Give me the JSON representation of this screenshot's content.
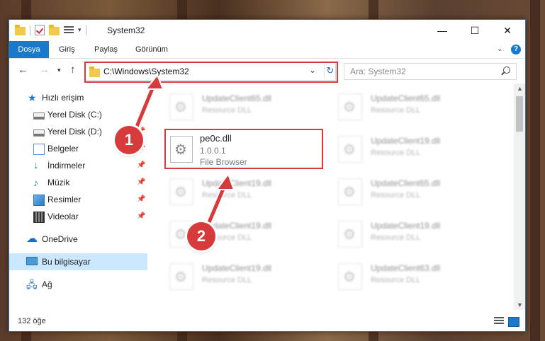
{
  "window": {
    "title": "System32",
    "minimize_icon": "minimize-icon",
    "maximize_icon": "maximize-icon",
    "close_icon": "close-icon"
  },
  "ribbon": {
    "tabs": [
      "Dosya",
      "Giriş",
      "Paylaş",
      "Görünüm"
    ]
  },
  "address": {
    "path": "C:\\Windows\\System32"
  },
  "search": {
    "placeholder": "Ara: System32"
  },
  "sidebar": {
    "items": [
      {
        "label": "Hızlı erişim",
        "icon": "star-icon"
      },
      {
        "label": "Yerel Disk (C:)",
        "icon": "drive-icon"
      },
      {
        "label": "Yerel Disk (D:)",
        "icon": "drive-icon"
      },
      {
        "label": "Belgeler",
        "icon": "documents-icon"
      },
      {
        "label": "İndirmeler",
        "icon": "download-icon"
      },
      {
        "label": "Müzik",
        "icon": "music-icon"
      },
      {
        "label": "Resimler",
        "icon": "pictures-icon"
      },
      {
        "label": "Videolar",
        "icon": "videos-icon"
      },
      {
        "label": "OneDrive",
        "icon": "cloud-icon"
      },
      {
        "label": "Bu bilgisayar",
        "icon": "computer-icon"
      },
      {
        "label": "Ağ",
        "icon": "network-icon"
      }
    ]
  },
  "files": {
    "background": [
      {
        "name": "UpdateClient65.dll",
        "desc": "Resource DLL"
      },
      {
        "name": "UpdateClient65.dll",
        "desc": "Resource DLL"
      },
      {
        "name": "UpdateClient19.dll",
        "desc": "Resource DLL"
      },
      {
        "name": "UpdateClient19.dll",
        "desc": "Resource DLL"
      },
      {
        "name": "UpdateClient65.dll",
        "desc": "Resource DLL"
      },
      {
        "name": "UpdateClient19.dll",
        "desc": "Resource DLL"
      },
      {
        "name": "UpdateClient19.dll",
        "desc": "Resource DLL"
      },
      {
        "name": "UpdateClient19.dll",
        "desc": "Resource DLL"
      },
      {
        "name": "UpdateClient63.dll",
        "desc": "Resource DLL"
      }
    ],
    "focus": {
      "name": "pe0c.dll",
      "version": "1.0.0.1",
      "desc": "File Browser"
    }
  },
  "status": {
    "count": "132 öğe"
  },
  "callouts": [
    "1",
    "2"
  ],
  "colors": {
    "accent": "#1979ca",
    "highlight": "#d63a3a"
  }
}
